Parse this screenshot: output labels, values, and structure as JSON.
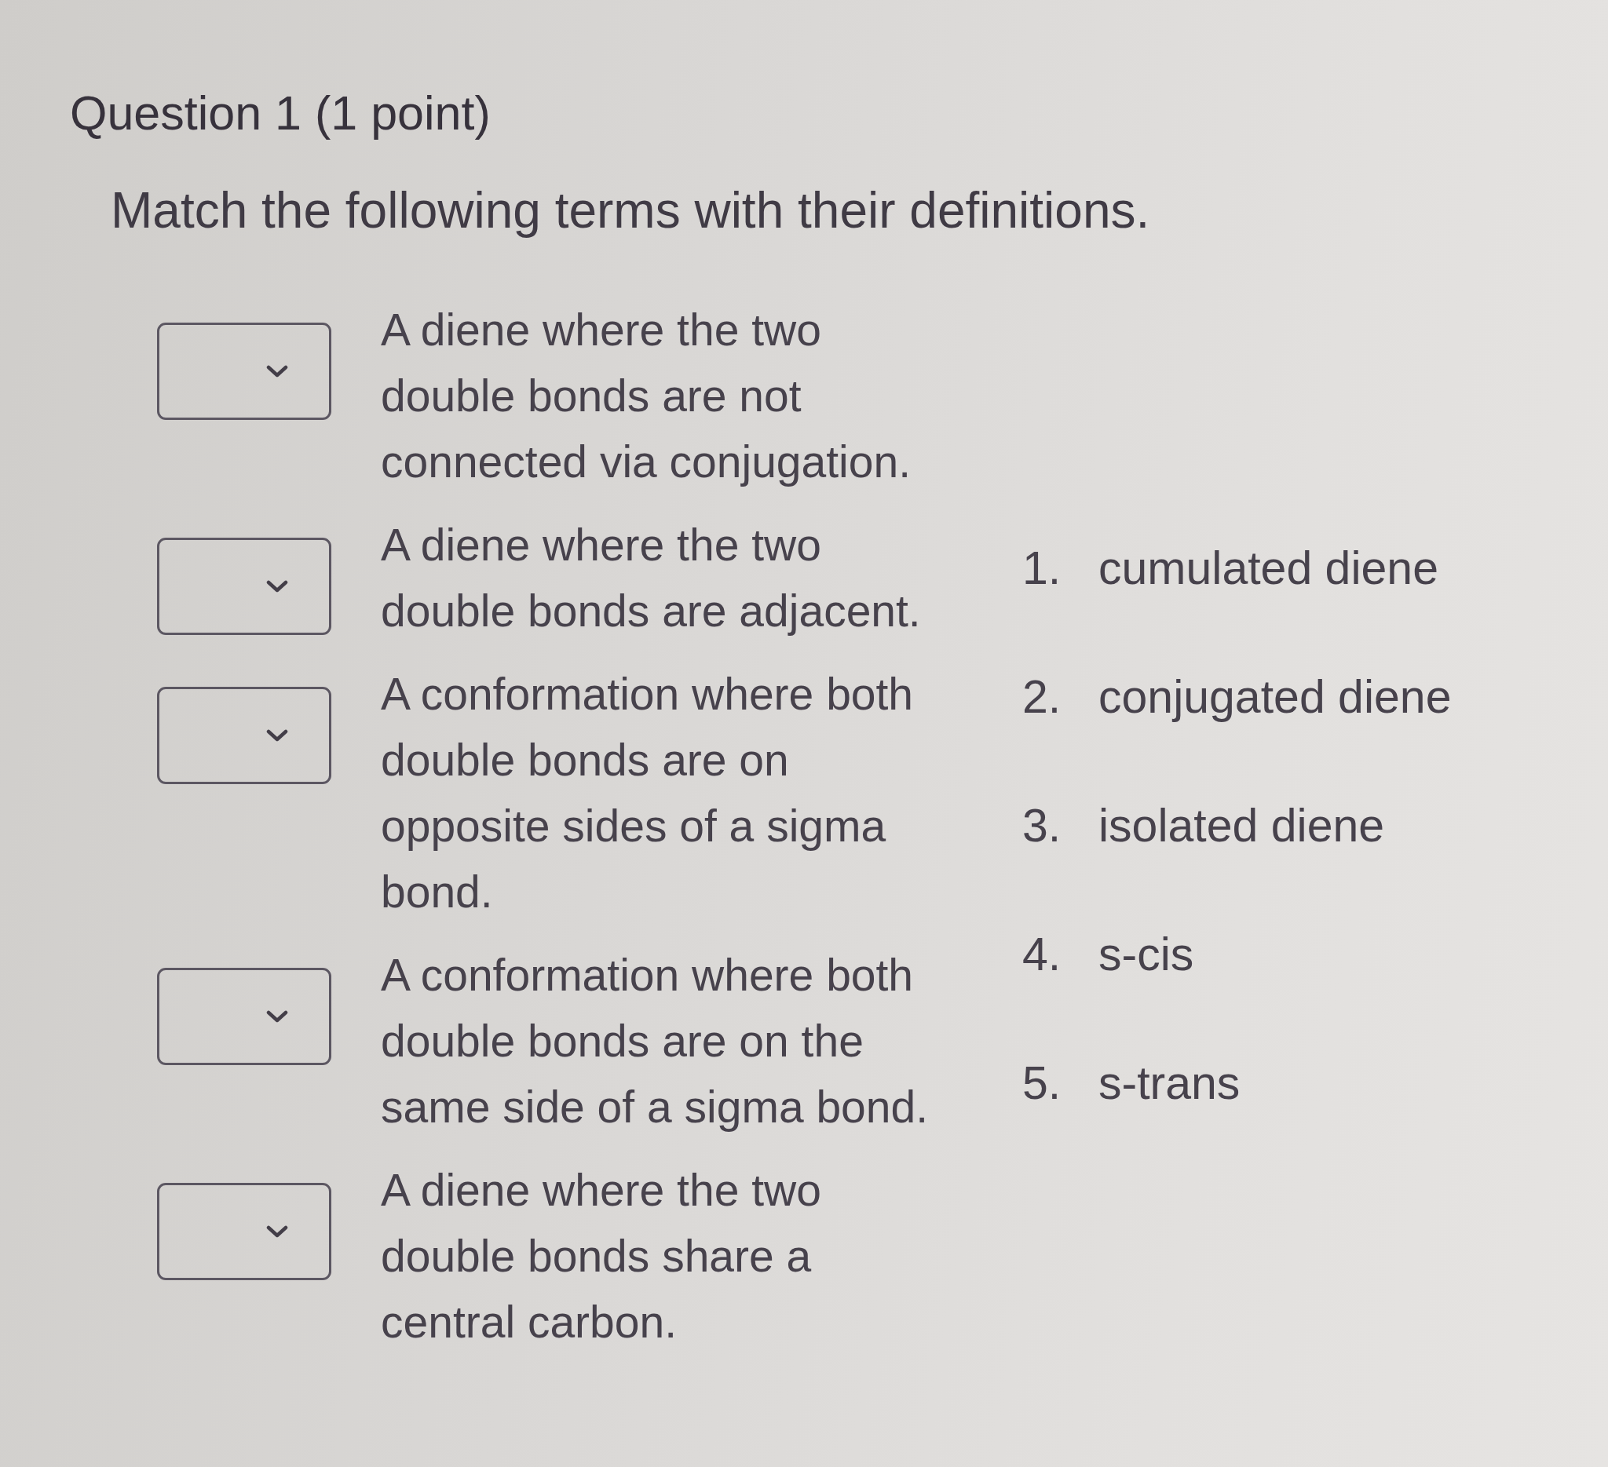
{
  "question": {
    "title": "Question 1 (1 point)",
    "prompt": "Match the following terms with their definitions."
  },
  "matches": [
    {
      "definition": "A diene where the two double bonds are not connected via conjugation."
    },
    {
      "definition": "A diene where the two double bonds are adjacent."
    },
    {
      "definition": "A conformation where both double bonds are on opposite sides of a sigma bond."
    },
    {
      "definition": "A conformation where both double bonds are on the same side of a sigma bond."
    },
    {
      "definition": "A diene where the two double bonds share a central carbon."
    }
  ],
  "choices": [
    {
      "number": "1.",
      "label": "cumulated diene"
    },
    {
      "number": "2.",
      "label": "conjugated diene"
    },
    {
      "number": "3.",
      "label": "isolated diene"
    },
    {
      "number": "4.",
      "label": "s-cis"
    },
    {
      "number": "5.",
      "label": "s-trans"
    }
  ]
}
